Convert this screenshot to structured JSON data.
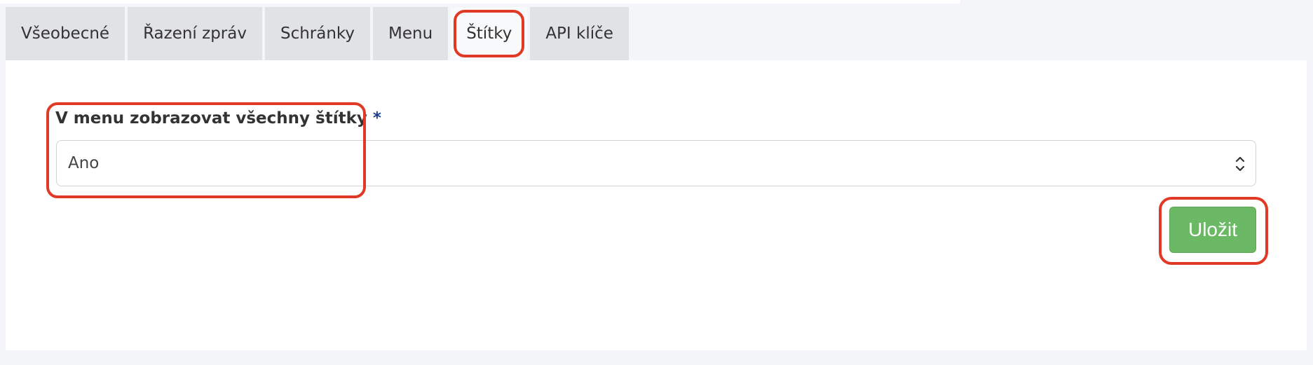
{
  "tabs": [
    {
      "label": "Všeobecné",
      "active": false
    },
    {
      "label": "Řazení zpráv",
      "active": false
    },
    {
      "label": "Schránky",
      "active": false
    },
    {
      "label": "Menu",
      "active": false
    },
    {
      "label": "Štítky",
      "active": true
    },
    {
      "label": "API klíče",
      "active": false
    }
  ],
  "form": {
    "label": "V menu zobrazovat všechny štítky",
    "required_mark": "*",
    "value": "Ano",
    "save_label": "Uložit"
  },
  "colors": {
    "highlight": "#e03a26",
    "save_button": "#6bb865",
    "required_mark": "#1d3f8a"
  },
  "icons": {
    "select_arrows": "chevron-up-down-icon"
  }
}
